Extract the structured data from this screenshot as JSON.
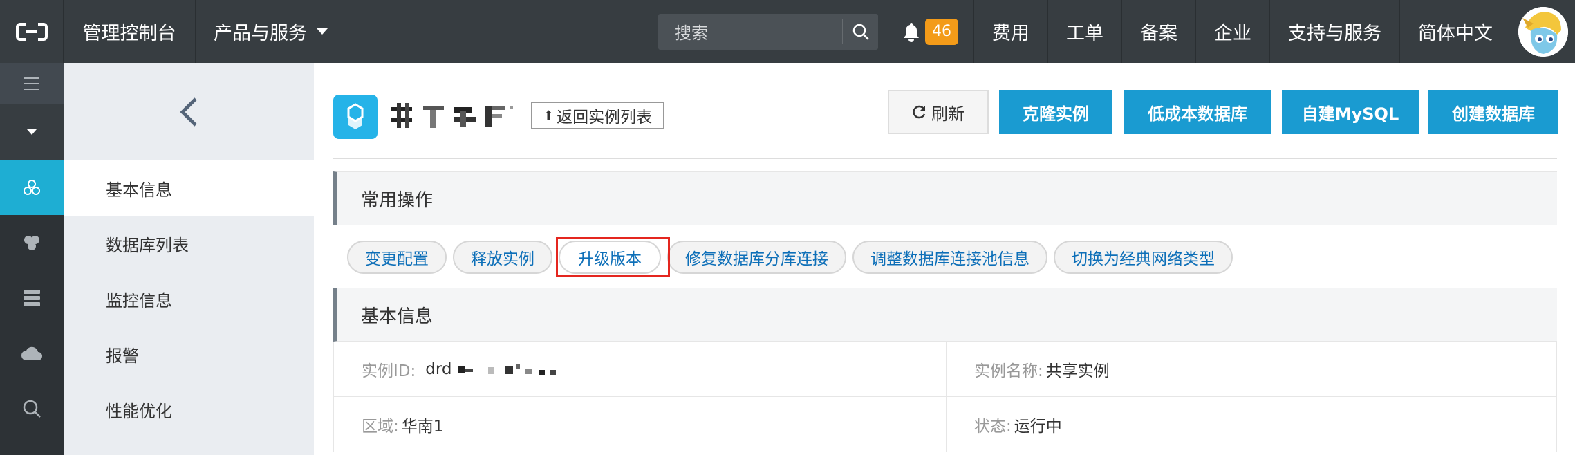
{
  "topbar": {
    "console_label": "管理控制台",
    "products_label": "产品与服务",
    "search_placeholder": "搜索",
    "notification_count": "46",
    "links": [
      "费用",
      "工单",
      "备案",
      "企业",
      "支持与服务",
      "简体中文"
    ]
  },
  "sidebar": {
    "items": [
      {
        "label": "基本信息",
        "active": true
      },
      {
        "label": "数据库列表",
        "active": false
      },
      {
        "label": "监控信息",
        "active": false
      },
      {
        "label": "报警",
        "active": false
      },
      {
        "label": "性能优化",
        "active": false
      }
    ]
  },
  "header": {
    "back_label": "返回实例列表",
    "refresh_label": "刷新",
    "buttons": [
      "克隆实例",
      "低成本数据库",
      "自建MySQL",
      "创建数据库"
    ]
  },
  "common_ops": {
    "title": "常用操作",
    "buttons": [
      "变更配置",
      "释放实例",
      "升级版本",
      "修复数据库分库连接",
      "调整数据库连接池信息",
      "切换为经典网络类型"
    ],
    "highlighted_index": 2
  },
  "basic_info": {
    "title": "基本信息",
    "instance_id_label": "实例ID:",
    "instance_id_value": "drd",
    "instance_name_label": "实例名称:",
    "instance_name_value": "共享实例",
    "region_label": "区域:",
    "region_value": "华南1",
    "status_label": "状态:",
    "status_value": "运行中"
  },
  "colors": {
    "topbar": "#373d41",
    "accent": "#1a9bd1",
    "rail_active": "#1eaed3",
    "badge": "#f39b19",
    "highlight_box": "#e4261f"
  }
}
